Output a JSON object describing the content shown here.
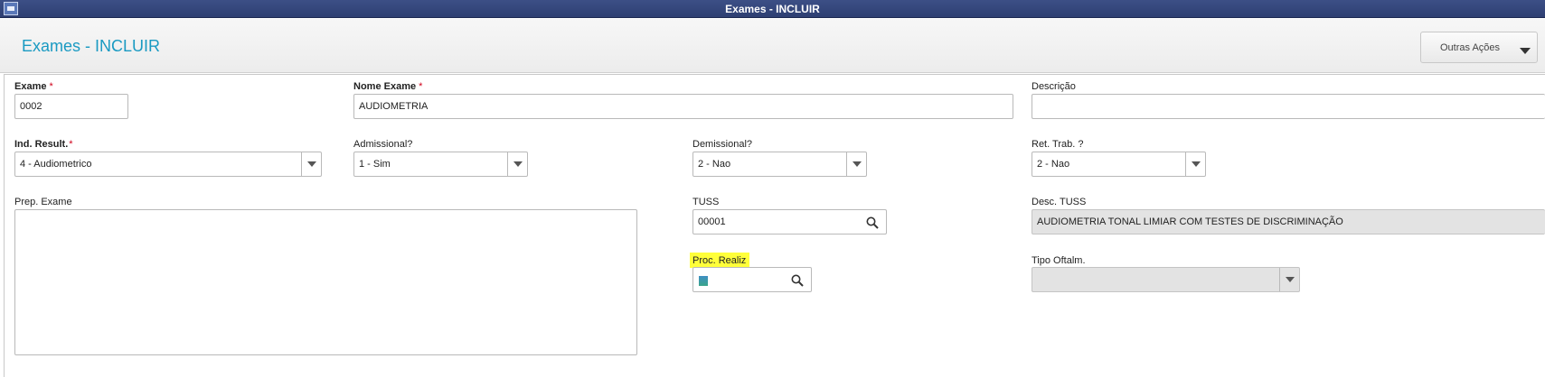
{
  "window": {
    "title": "Exames - INCLUIR"
  },
  "header": {
    "page_title": "Exames - INCLUIR",
    "actions_label": "Outras Ações"
  },
  "form": {
    "exame": {
      "label": "Exame",
      "value": "0002"
    },
    "nome_exame": {
      "label": "Nome Exame",
      "value": "AUDIOMETRIA"
    },
    "descricao": {
      "label": "Descrição",
      "value": ""
    },
    "ind_result": {
      "label": "Ind. Result.",
      "value": "4 - Audiometrico"
    },
    "admissional": {
      "label": "Admissional?",
      "value": "1 - Sim"
    },
    "demissional": {
      "label": "Demissional?",
      "value": "2 - Nao"
    },
    "ret_trab": {
      "label": "Ret. Trab. ?",
      "value": "2 - Nao"
    },
    "prep_exame": {
      "label": "Prep. Exame",
      "value": ""
    },
    "tuss": {
      "label": "TUSS",
      "value": "00001"
    },
    "desc_tuss": {
      "label": "Desc. TUSS",
      "value": "AUDIOMETRIA TONAL LIMIAR COM TESTES DE DISCRIMINAÇÃO"
    },
    "proc_realiz": {
      "label": "Proc. Realiz",
      "value": ""
    },
    "tipo_oftalm": {
      "label": "Tipo Oftalm.",
      "value": ""
    },
    "required_mark": "*"
  },
  "colors": {
    "accent": "#1a9ac2",
    "titlebar": "#34467c",
    "required": "#d0021b",
    "highlight": "#ffff3a"
  },
  "icons": {
    "search": "search-icon",
    "dropdown": "chevron-down-icon",
    "app": "window-icon"
  }
}
